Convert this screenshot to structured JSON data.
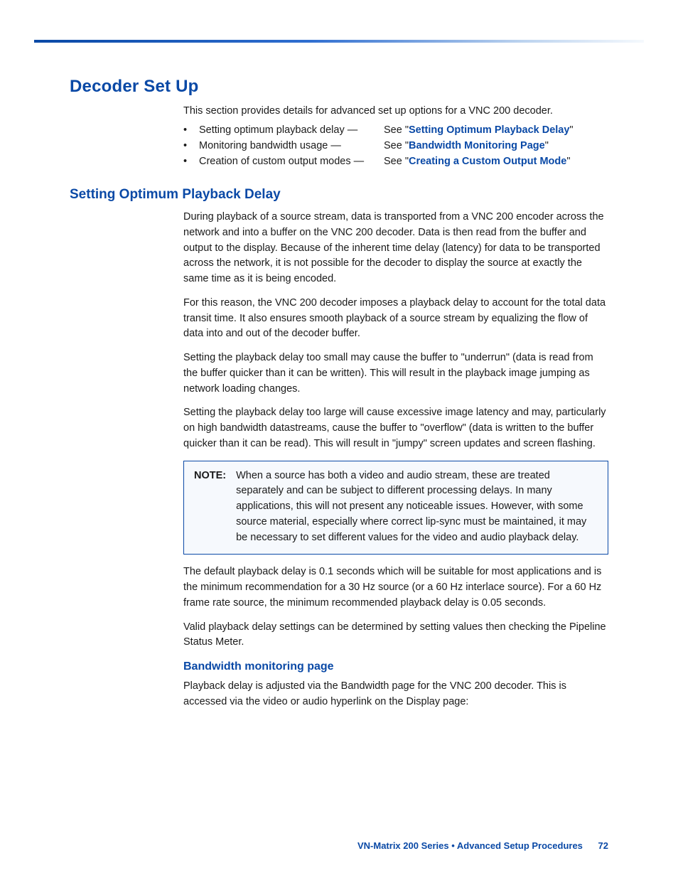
{
  "title": "Decoder Set Up",
  "intro": "This section provides details for advanced set up options for a VNC 200 decoder.",
  "toc": [
    {
      "lhs": "Setting optimum playback delay —",
      "see_prefix": "See \"",
      "link": "Setting Optimum Playback Delay",
      "see_suffix": "\""
    },
    {
      "lhs": "Monitoring bandwidth usage —",
      "see_prefix": "See \"",
      "link": "Bandwidth Monitoring Page",
      "see_suffix": "\""
    },
    {
      "lhs": "Creation of custom output modes —",
      "see_prefix": "See \"",
      "link": "Creating a Custom Output Mode",
      "see_suffix": "\""
    }
  ],
  "sub1_title": "Setting Optimum Playback Delay",
  "p1": "During playback of a source stream, data is transported from a VNC 200 encoder across the network and into a buffer on the VNC 200 decoder. Data is then read from the buffer and output to the display. Because of the inherent time delay (latency) for data to be transported across the network, it is not possible for the decoder to display the source at exactly the same time as it is being encoded.",
  "p2": "For this reason, the VNC 200 decoder imposes a playback delay to account for the total data transit time. It also ensures smooth playback of a source stream by equalizing the flow of data into and out of the decoder buffer.",
  "p3": "Setting the playback delay too small may cause the buffer to \"underrun\" (data is read from the buffer quicker than it can be written). This will result in the playback image jumping as network loading changes.",
  "p4": "Setting the playback delay too large will cause excessive image latency and may, particularly on high bandwidth datastreams, cause the buffer to \"overflow\" (data is written to the buffer quicker than it can be read). This will result in \"jumpy\" screen updates and screen flashing.",
  "note_label": "NOTE:",
  "note_text": "When a source has both a video and audio stream, these are treated separately and can be subject to different processing delays. In many applications, this will not present any noticeable issues. However, with some source material, especially where correct lip-sync must be maintained, it may be necessary to set different values for the video and audio playback delay.",
  "p5": "The default playback delay is 0.1 seconds which will be suitable for most applications and is the minimum recommendation for a 30 Hz source (or a 60 Hz interlace source). For a 60 Hz frame rate source, the minimum recommended playback delay is 0.05 seconds.",
  "p6": "Valid playback delay settings can be determined by setting values then checking the Pipeline Status Meter.",
  "sub2_title": "Bandwidth monitoring page",
  "p7": "Playback delay is adjusted via the Bandwidth page for the VNC 200 decoder. This is accessed via the video or audio hyperlink on the Display page:",
  "footer_title": "VN-Matrix 200 Series  •  Advanced Setup Procedures",
  "page_number": "72"
}
